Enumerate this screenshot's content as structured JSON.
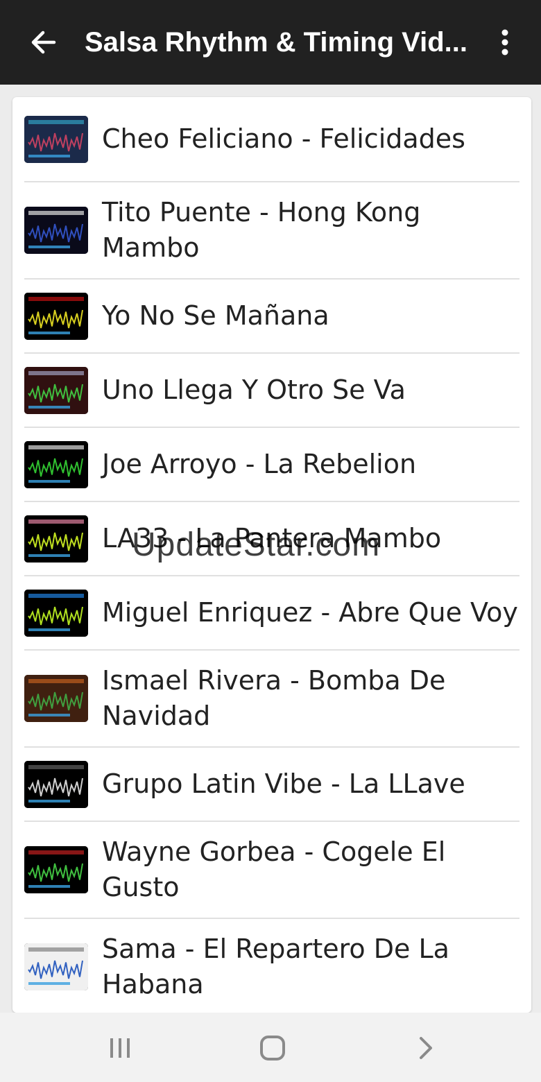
{
  "appbar": {
    "title": "Salsa Rhythm & Timing Vid...",
    "back_icon": "arrow-left-icon",
    "menu_icon": "more-vertical-icon"
  },
  "list": {
    "items": [
      {
        "label": "Cheo Feliciano - Felicidades",
        "thumb_colors": [
          "#1b2a4a",
          "#c04060",
          "#30a0c0"
        ]
      },
      {
        "label": "Tito Puente - Hong Kong Mambo",
        "thumb_colors": [
          "#0a0a1a",
          "#3050c0",
          "#e0e0e0"
        ]
      },
      {
        "label": "Yo No Se Mañana",
        "thumb_colors": [
          "#000000",
          "#d8d020",
          "#c01010"
        ]
      },
      {
        "label": "Uno Llega Y Otro Se Va",
        "thumb_colors": [
          "#301010",
          "#40c040",
          "#a0a0c0"
        ]
      },
      {
        "label": "Joe Arroyo - La Rebelion",
        "thumb_colors": [
          "#000000",
          "#30c030",
          "#e0e0e0"
        ]
      },
      {
        "label": "LA33 - La Pantera Mambo",
        "thumb_colors": [
          "#000000",
          "#c0e020",
          "#e080a0"
        ]
      },
      {
        "label": "Miguel Enriquez - Abre Que Voy",
        "thumb_colors": [
          "#000000",
          "#b0e020",
          "#2080e0"
        ]
      },
      {
        "label": "Ismael Rivera - Bomba De Navidad",
        "thumb_colors": [
          "#402010",
          "#40a040",
          "#c06020"
        ]
      },
      {
        "label": "Grupo Latin Vibe - La LLave",
        "thumb_colors": [
          "#000000",
          "#d0d0d0",
          "#606060"
        ]
      },
      {
        "label": "Wayne Gorbea - Cogele El Gusto",
        "thumb_colors": [
          "#000000",
          "#40c040",
          "#c02020"
        ]
      },
      {
        "label": "Sama - El Repartero De La Habana",
        "thumb_colors": [
          "#f0f0f0",
          "#3060c0",
          "#808080"
        ]
      }
    ]
  },
  "watermark": "UpdateStar.com",
  "navbar": {
    "recents_icon": "recents-icon",
    "home_icon": "home-icon",
    "back_icon": "chevron-right-icon"
  }
}
